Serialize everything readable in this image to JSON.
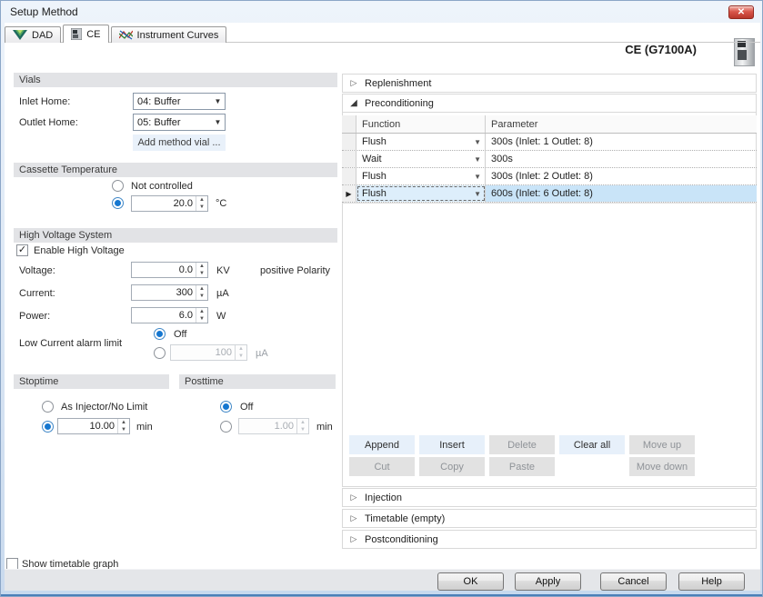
{
  "window": {
    "title": "Setup Method",
    "close_glyph": "✕"
  },
  "tabs": [
    {
      "label": "DAD"
    },
    {
      "label": "CE"
    },
    {
      "label": "Instrument Curves"
    }
  ],
  "left_panel": {
    "vials": {
      "header": "Vials",
      "inlet_label": "Inlet Home:",
      "inlet_value": "04: Buffer",
      "outlet_label": "Outlet Home:",
      "outlet_value": "05: Buffer",
      "add_button": "Add method vial ..."
    },
    "cassette": {
      "header": "Cassette Temperature",
      "not_controlled_label": "Not controlled",
      "temp_value": "20.0",
      "temp_unit": "°C"
    },
    "hvs": {
      "header": "High Voltage System",
      "enable_label": "Enable High Voltage",
      "voltage_label": "Voltage:",
      "voltage_value": "0.0",
      "voltage_unit": "KV",
      "polarity_text": "positive Polarity",
      "current_label": "Current:",
      "current_value": "300",
      "current_unit": "µA",
      "power_label": "Power:",
      "power_value": "6.0",
      "power_unit": "W",
      "low_current_label": "Low Current alarm limit",
      "off_label": "Off",
      "limit_value": "100",
      "limit_unit": "µA"
    },
    "stoptime": {
      "header": "Stoptime",
      "as_injector_label": "As Injector/No Limit",
      "value": "10.00",
      "unit": "min"
    },
    "posttime": {
      "header": "Posttime",
      "off_label": "Off",
      "value": "1.00",
      "unit": "min"
    }
  },
  "right_panel": {
    "device_title": "CE (G7100A)",
    "sections": {
      "replenishment": "Replenishment",
      "preconditioning": "Preconditioning",
      "injection": "Injection",
      "timetable": "Timetable (empty)",
      "postconditioning": "Postconditioning"
    },
    "table": {
      "headers": {
        "function": "Function",
        "parameter": "Parameter"
      },
      "rows": [
        {
          "function": "Flush",
          "parameter": "300s (Inlet: 1 Outlet: 8)"
        },
        {
          "function": "Wait",
          "parameter": "300s"
        },
        {
          "function": "Flush",
          "parameter": "300s (Inlet: 2 Outlet: 8)"
        },
        {
          "function": "Flush",
          "parameter": "600s (Inlet: 6 Outlet: 8)"
        }
      ],
      "selected_row_index": 3
    },
    "buttons": {
      "append": "Append",
      "insert": "Insert",
      "delete": "Delete",
      "clear_all": "Clear all",
      "move_up": "Move up",
      "cut": "Cut",
      "copy": "Copy",
      "paste": "Paste",
      "move_down": "Move down"
    }
  },
  "footer": {
    "show_graph_label": "Show timetable graph",
    "ok": "OK",
    "apply": "Apply",
    "cancel": "Cancel",
    "help": "Help"
  },
  "colors": {
    "selected_row": "#c9e4f8",
    "enabled_button_bg": "#e7f0fa",
    "disabled_button_bg": "#e2e2e2",
    "radio_accent": "#1577d0",
    "close_button_red": "#c84238",
    "window_frame": "#c9daee"
  }
}
